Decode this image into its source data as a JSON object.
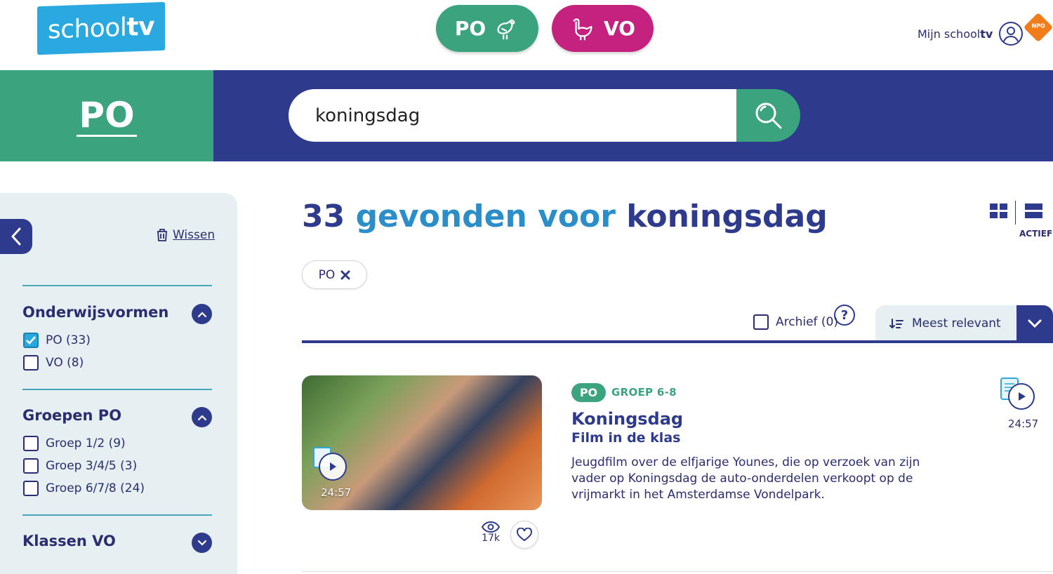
{
  "header": {
    "logo": {
      "part1": "school",
      "part2": "tv"
    },
    "po_label": "PO",
    "vo_label": "VO",
    "mijn": {
      "part1": "Mijn school",
      "part2": "tv"
    },
    "npo_label": "NPO"
  },
  "banner": {
    "section": "PO",
    "search_value": "koningsdag"
  },
  "sidebar": {
    "clear_label": "Wissen",
    "groups": [
      {
        "title": "Onderwijsvormen",
        "expanded": true,
        "options": [
          {
            "label": "PO (33)",
            "checked": true
          },
          {
            "label": "VO (8)",
            "checked": false
          }
        ]
      },
      {
        "title": "Groepen PO",
        "expanded": true,
        "options": [
          {
            "label": "Groep 1/2 (9)",
            "checked": false
          },
          {
            "label": "Groep 3/4/5 (3)",
            "checked": false
          },
          {
            "label": "Groep 6/7/8 (24)",
            "checked": false
          }
        ]
      },
      {
        "title": "Klassen VO",
        "expanded": false,
        "options": []
      }
    ]
  },
  "results": {
    "count": "33",
    "mid": "gevonden voor",
    "query": "koningsdag",
    "view_active_label": "ACTIEF",
    "active_filter": "PO",
    "archief_label": "Archief (0)",
    "help_label": "?",
    "sort_label": "Meest relevant"
  },
  "card": {
    "badge": "PO",
    "groep": "GROEP 6-8",
    "title": "Koningsdag",
    "subtitle": "Film in de klas",
    "description": "Jeugdfilm over de elfjarige Younes, die op verzoek van zijn vader op Koningsdag de auto-onderdelen verkoopt op de vrijmarkt in het Amsterdamse Vondelpark.",
    "duration": "24:57",
    "views": "17k"
  },
  "colors": {
    "po_green": "#3ca37f",
    "vo_magenta": "#c5227f",
    "navy": "#2e3a8c",
    "logo_blue": "#29a9e0",
    "sidebar_bg": "#e6eff1"
  }
}
